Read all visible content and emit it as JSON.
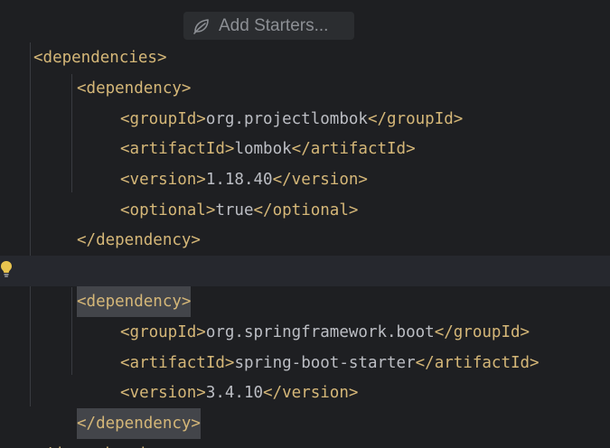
{
  "inlay_hint": {
    "label": "Add Starters...",
    "icon": "spring-leaf-icon"
  },
  "colors": {
    "background": "#1e1f22",
    "current_line": "#26282e",
    "tag": "#d5b778",
    "text": "#bcbec4",
    "bracket_match": "#43454a",
    "bulb": "#e8c44f"
  },
  "code": {
    "l1": {
      "tag_open": "<dependencies>"
    },
    "l2": {
      "tag_open": "<dependency>"
    },
    "l3": {
      "tag_open": "<groupId>",
      "value": "org.projectlombok",
      "tag_close": "</groupId>"
    },
    "l4": {
      "tag_open": "<artifactId>",
      "value": "lombok",
      "tag_close": "</artifactId>"
    },
    "l5": {
      "tag_open": "<version>",
      "value": "1.18.40",
      "tag_close": "</version>"
    },
    "l6": {
      "tag_open": "<optional>",
      "value": "true",
      "tag_close": "</optional>"
    },
    "l7": {
      "tag_close": "</dependency>"
    },
    "l9": {
      "tag_open": "<dependency>"
    },
    "l10": {
      "tag_open": "<groupId>",
      "value": "org.springframework.boot",
      "tag_close": "</groupId>"
    },
    "l11": {
      "tag_open": "<artifactId>",
      "value": "spring-boot-starter",
      "tag_close": "</artifactId>"
    },
    "l12": {
      "tag_open": "<version>",
      "value": "3.4.10",
      "tag_close": "</version>"
    },
    "l13": {
      "tag_close": "</dependency>"
    },
    "l14": {
      "tag_close": "</dependencies>"
    }
  }
}
